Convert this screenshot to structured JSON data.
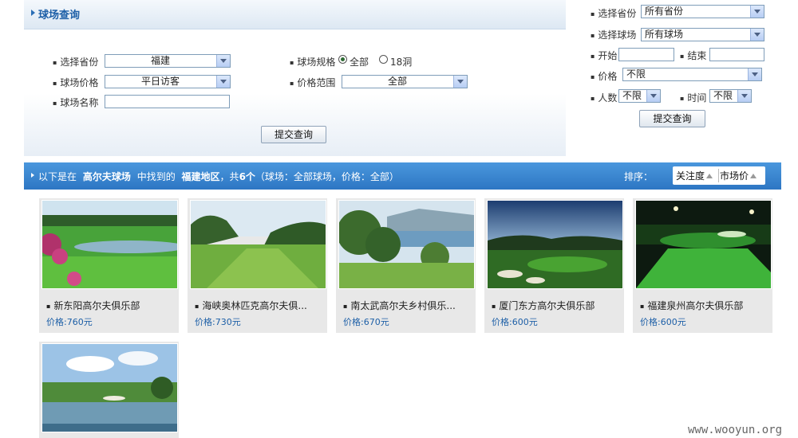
{
  "search_panel": {
    "title": "球场查询",
    "province_label": "选择省份",
    "province_value": "福建",
    "price_label": "球场价格",
    "price_value": "平日访客",
    "name_label": "球场名称",
    "spec_label": "球场规格",
    "spec_all": "全部",
    "spec_18": "18洞",
    "range_label": "价格范围",
    "range_value": "全部",
    "submit": "提交查询"
  },
  "side_panel": {
    "province_label": "选择省份",
    "province_value": "所有省份",
    "course_label": "选择球场",
    "course_value": "所有球场",
    "start_label": "开始",
    "end_label": "结束",
    "price_label": "价格",
    "price_value": "不限",
    "people_label": "人数",
    "people_value": "不限",
    "time_label": "时间",
    "time_value": "不限",
    "submit": "提交查询"
  },
  "result_bar": {
    "prefix": "以下是在",
    "keyword": "高尔夫球场",
    "mid": "中找到的",
    "region": "福建地区",
    "count_prefix": "，共",
    "count": "6个",
    "suffix": "（球场：全部球场，价格：全部）",
    "sort_label": "排序：",
    "sort_follow": "关注度",
    "sort_market": "市场价"
  },
  "courses": [
    {
      "name": "新东阳高尔夫俱乐部",
      "price": "价格:760元"
    },
    {
      "name": "海峡奥林匹克高尔夫俱...",
      "price": "价格:730元"
    },
    {
      "name": "南太武高尔夫乡村俱乐...",
      "price": "价格:670元"
    },
    {
      "name": "厦门东方高尔夫俱乐部",
      "price": "价格:600元"
    },
    {
      "name": "福建泉州高尔夫俱乐部",
      "price": "价格:600元"
    },
    {
      "name": "",
      "price": ""
    }
  ],
  "watermark": "www.wooyun.org"
}
